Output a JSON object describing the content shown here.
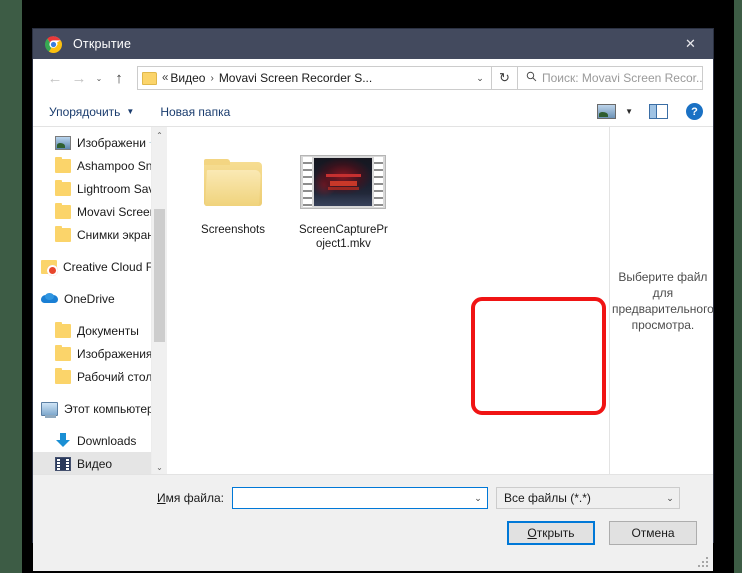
{
  "window": {
    "title": "Открытие",
    "app_icon": "chrome-icon",
    "close_label": "✕"
  },
  "nav": {
    "back_icon": "←",
    "forward_icon": "→",
    "history_icon": "⌄",
    "up_icon": "↑",
    "breadcrumb": {
      "overflow": "«",
      "root": "Видео",
      "arrow": "›",
      "current": "Movavi Screen Recorder S...",
      "dropdown_icon": "⌄"
    },
    "refresh_icon": "↻",
    "search": {
      "icon": "search-icon",
      "placeholder": "Поиск: Movavi Screen Recor..."
    }
  },
  "commandbar": {
    "organize": "Упорядочить",
    "organize_caret": "▼",
    "new_folder": "Новая папка",
    "view_caret": "▼",
    "help_label": "?"
  },
  "sidebar": {
    "items": [
      {
        "label": "Изображени",
        "icon": "picture-icon",
        "indent": 1,
        "pinned": true,
        "selected": false
      },
      {
        "label": "Ashampoo Snap",
        "icon": "folder-icon",
        "indent": 1,
        "pinned": false,
        "selected": false
      },
      {
        "label": "Lightroom Saved",
        "icon": "folder-icon",
        "indent": 1,
        "pinned": false,
        "selected": false
      },
      {
        "label": "Movavi Screen R",
        "icon": "folder-icon",
        "indent": 1,
        "pinned": false,
        "selected": false
      },
      {
        "label": "Снимки экрана",
        "icon": "folder-icon",
        "indent": 1,
        "pinned": false,
        "selected": false
      },
      {
        "label": "Creative Cloud Fil",
        "icon": "creative-cloud-icon",
        "indent": 0,
        "pinned": false,
        "selected": false
      },
      {
        "label": "OneDrive",
        "icon": "onedrive-icon",
        "indent": 0,
        "pinned": false,
        "selected": false
      },
      {
        "label": "Документы",
        "icon": "folder-icon",
        "indent": 1,
        "pinned": false,
        "selected": false
      },
      {
        "label": "Изображения",
        "icon": "folder-icon",
        "indent": 1,
        "pinned": false,
        "selected": false
      },
      {
        "label": "Рабочий стол",
        "icon": "folder-icon",
        "indent": 1,
        "pinned": false,
        "selected": false
      },
      {
        "label": "Этот компьютер",
        "icon": "computer-icon",
        "indent": 0,
        "pinned": false,
        "selected": false
      },
      {
        "label": "Downloads",
        "icon": "download-icon",
        "indent": 1,
        "pinned": false,
        "selected": false
      },
      {
        "label": "Видео",
        "icon": "video-icon",
        "indent": 1,
        "pinned": false,
        "selected": true
      }
    ],
    "scrollbar": {
      "up_icon": "⌃",
      "down_icon": "⌄"
    }
  },
  "files": {
    "items": [
      {
        "name": "Screenshots",
        "kind": "folder"
      },
      {
        "name": "ScreenCaptureProject1.mkv",
        "kind": "video"
      }
    ]
  },
  "annotation": {
    "highlight_color": "#f01414",
    "target": "ScreenCaptureProject1.mkv"
  },
  "preview": {
    "message": "Выберите файл для предварительного просмотра."
  },
  "bottom": {
    "filename_label_first": "И",
    "filename_label_rest": "мя файла:",
    "filename_value": "",
    "filename_caret": "⌄",
    "filter_value": "Все файлы (*.*)",
    "filter_caret": "⌄",
    "open_label_first": "О",
    "open_label_rest": "ткрыть",
    "cancel_label": "Отмена"
  }
}
